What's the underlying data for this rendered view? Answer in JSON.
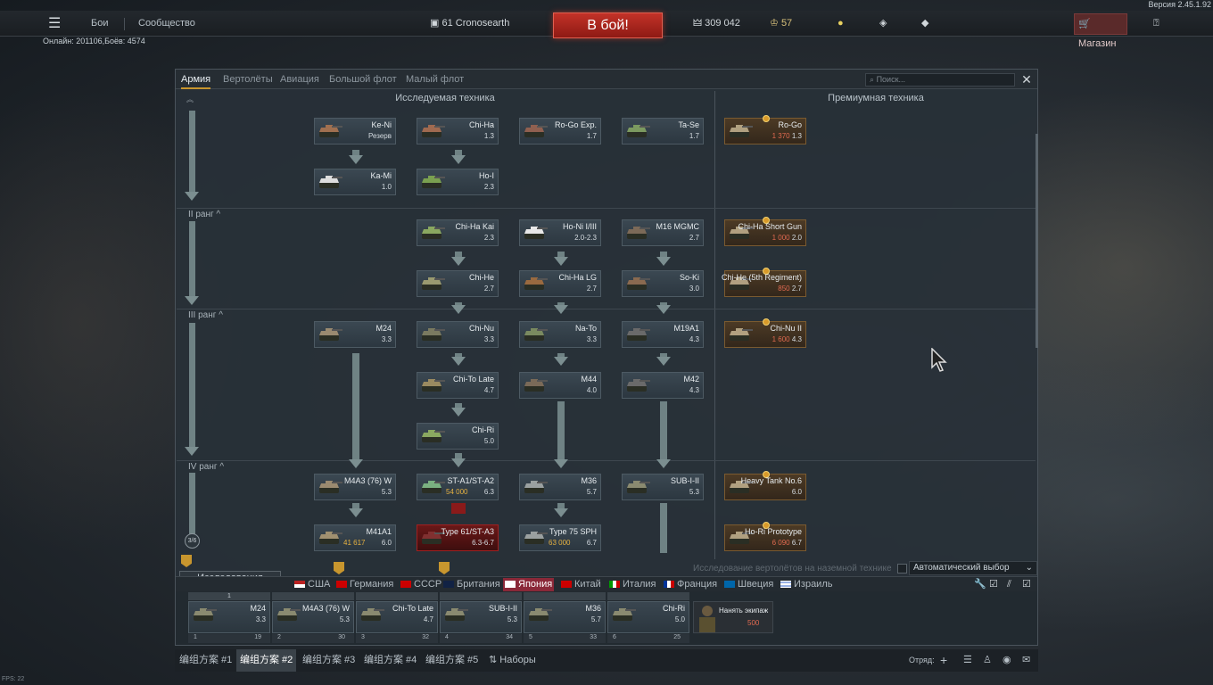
{
  "version": "Версия 2.45.1.92",
  "online": "Онлайн: 201106,Боёв: 4574",
  "topbar": {
    "battles": "Бои",
    "community": "Сообщество",
    "level": "61",
    "nickname": "Cronosearth",
    "battle_button": "В бой!",
    "silver": "309 042",
    "gold": "57",
    "shop": "Магазин",
    "help": "?"
  },
  "panel": {
    "tabs": [
      "Армия",
      "Вертолёты",
      "Авиация",
      "Большой флот",
      "Малый флот"
    ],
    "search_placeholder": "Поиск...",
    "close": "✕",
    "col_research": "Исследуемая техника",
    "col_premium": "Премиумная техника",
    "rank2": "II ранг",
    "rank3": "III ранг",
    "rank4": "IV ранг",
    "rank_progress": "3/6",
    "cards": [
      {
        "name": "Ke-Ni",
        "br": "Резерв"
      },
      {
        "name": "Chi-Ha",
        "br": "1.3"
      },
      {
        "name": "Ro-Go Exp.",
        "br": "1.7"
      },
      {
        "name": "Ta-Se",
        "br": "1.7"
      },
      {
        "name": "Ka-Mi",
        "br": "1.0"
      },
      {
        "name": "Ho-I",
        "br": "2.3"
      },
      {
        "name": "Chi-Ha Kai",
        "br": "2.3"
      },
      {
        "name": "Ho-Ni I/III",
        "br": "2.0-2.3"
      },
      {
        "name": "M16 MGMC",
        "br": "2.7"
      },
      {
        "name": "Chi-He",
        "br": "2.7"
      },
      {
        "name": "Chi-Ha LG",
        "br": "2.7"
      },
      {
        "name": "So-Ki",
        "br": "3.0"
      },
      {
        "name": "M24",
        "br": "3.3"
      },
      {
        "name": "Chi-Nu",
        "br": "3.3"
      },
      {
        "name": "Na-To",
        "br": "3.3"
      },
      {
        "name": "M19A1",
        "br": "4.3"
      },
      {
        "name": "Chi-To Late",
        "br": "4.7"
      },
      {
        "name": "M44",
        "br": "4.0"
      },
      {
        "name": "M42",
        "br": "4.3"
      },
      {
        "name": "Chi-Ri",
        "br": "5.0"
      },
      {
        "name": "M4A3 (76) W",
        "br": "5.3"
      },
      {
        "name": "ST-A1/ST-A2",
        "br": "6.3",
        "price": "54 000"
      },
      {
        "name": "M36",
        "br": "5.7"
      },
      {
        "name": "SUB-I-II",
        "br": "5.3"
      },
      {
        "name": "M41A1",
        "br": "6.0",
        "price": "41 617"
      },
      {
        "name": "Type 61/ST-A3",
        "br": "6.3-6.7"
      },
      {
        "name": "Type 75 SPH",
        "br": "6.7",
        "price": "63 000"
      }
    ],
    "premium": [
      {
        "name": "Ro-Go",
        "price": "1 370",
        "br": "1.3"
      },
      {
        "name": "Chi-Ha Short Gun",
        "price": "1 000",
        "br": "2.0"
      },
      {
        "name": "Chi-He (5th Regiment)",
        "price": "850",
        "br": "2.7"
      },
      {
        "name": "Chi-Nu II",
        "price": "1 600",
        "br": "4.3"
      },
      {
        "name": "Heavy Tank No.6",
        "price": "",
        "br": "6.0"
      },
      {
        "name": "Ho-Ri Prototype",
        "price": "6 090",
        "br": "6.7"
      }
    ],
    "heli_research": "Исследование вертолётов на наземной технике",
    "auto_select": "Автоматический выбор",
    "research_tab": "Исследования",
    "nations": [
      "США",
      "Германия",
      "СССР",
      "Британия",
      "Япония",
      "Китай",
      "Италия",
      "Франция",
      "Швеция",
      "Израиль"
    ],
    "crew": [
      {
        "name": "M24",
        "br": "3.3",
        "num": "1",
        "right": "19"
      },
      {
        "name": "M4A3 (76) W",
        "br": "5.3",
        "num": "2",
        "right": "30"
      },
      {
        "name": "Chi-To Late",
        "br": "4.7",
        "num": "3",
        "right": "32"
      },
      {
        "name": "SUB-I-II",
        "br": "5.3",
        "num": "4",
        "right": "34"
      },
      {
        "name": "M36",
        "br": "5.7",
        "num": "5",
        "right": "33"
      },
      {
        "name": "Chi-Ri",
        "br": "5.0",
        "num": "6",
        "right": "25"
      }
    ],
    "hire_crew": "Нанять экипаж",
    "hire_price": "500",
    "crew_top1": "1"
  },
  "presets": [
    "编组方案 #1",
    "编组方案 #2",
    "编组方案 #3",
    "编组方案 #4",
    "编组方案 #5"
  ],
  "sets_label": "Наборы",
  "squad": "Отряд:",
  "fps": "FPS: 22",
  "colors": {
    "accent": "#c8962e",
    "battle": "#c33228",
    "premium_bg": "#4c3a25",
    "nation_active": "#8a2838"
  }
}
